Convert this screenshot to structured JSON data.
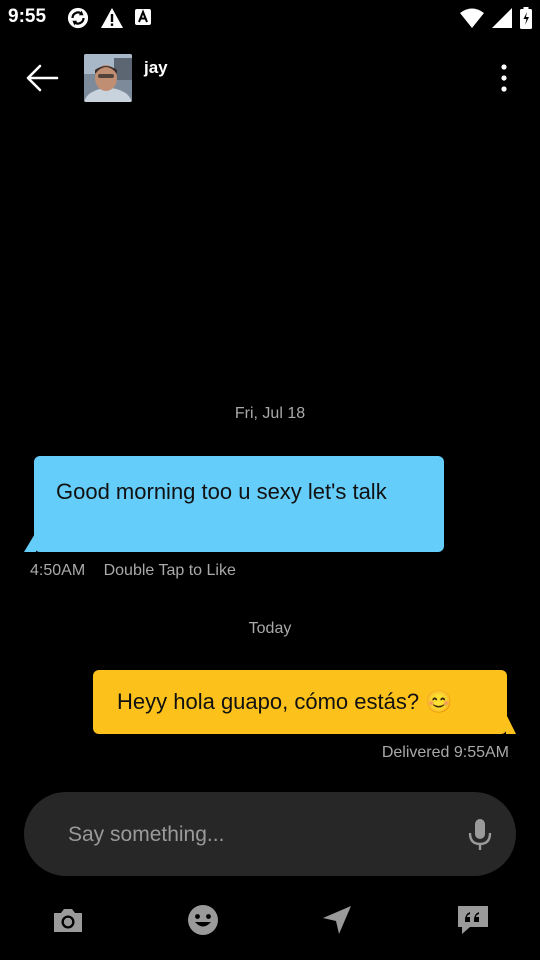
{
  "status_bar": {
    "time": "9:55",
    "left_icons": [
      "sync-icon",
      "warning-icon",
      "font-icon"
    ],
    "right_icons": [
      "wifi-icon",
      "signal-icon",
      "battery-icon"
    ]
  },
  "header": {
    "contact_name": "jay",
    "back_icon": "arrow-left-icon",
    "menu_icon": "more-vertical-icon"
  },
  "conversation": {
    "earlier_date": "Fri, Jul 18",
    "incoming": {
      "text": "Good morning too u sexy let's talk",
      "time": "4:50AM",
      "hint": "Double Tap to Like",
      "color": "#64cdfa"
    },
    "today_label": "Today",
    "outgoing": {
      "text": "Heyy hola guapo, cómo estás? 😊",
      "status": "Delivered 9:55AM",
      "color": "#fcc21b"
    }
  },
  "composer": {
    "placeholder": "Say something...",
    "value": "",
    "mic_icon": "microphone-icon"
  },
  "toolbar": {
    "items": [
      "camera-icon",
      "emoji-icon",
      "location-icon",
      "saved-phrases-icon"
    ]
  }
}
